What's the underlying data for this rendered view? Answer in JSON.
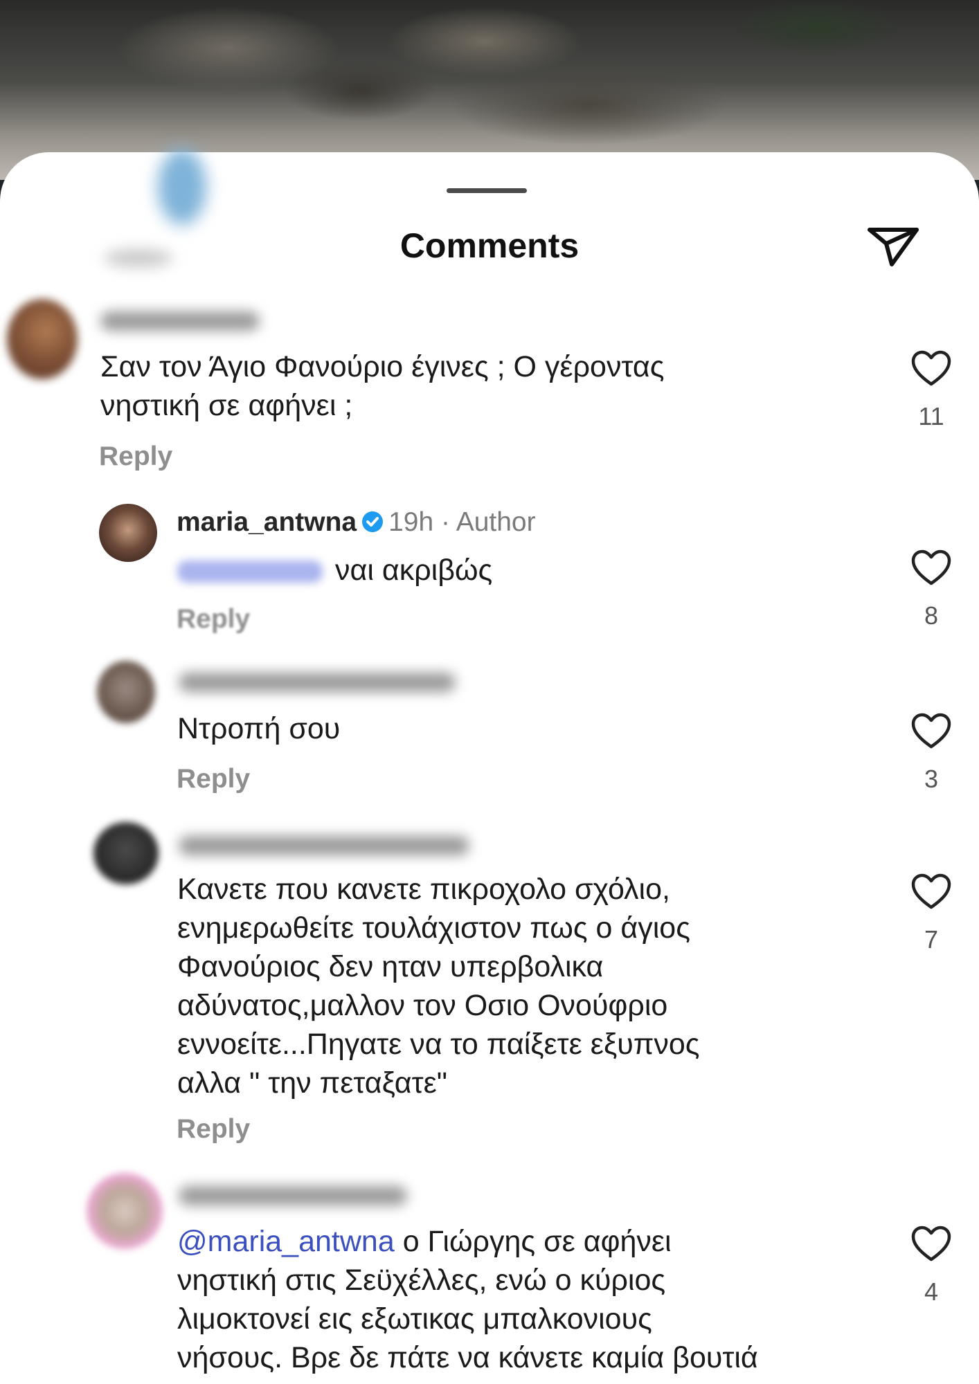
{
  "sheet": {
    "title": "Comments"
  },
  "comments": [
    {
      "text": "Σαν τον Άγιο Φανούριο έγινες ; Ο γέροντας\nνηστική σε αφήνει ;",
      "reply_label": "Reply",
      "likes": "11"
    },
    {
      "username": "maria_antwna",
      "time": "19h",
      "tag": "Author",
      "text": "ναι ακριβώς",
      "reply_label": "Reply",
      "likes": "8"
    },
    {
      "text": "Ντροπή σου",
      "reply_label": "Reply",
      "likes": "3"
    },
    {
      "text": "Κανετε που κανετε πικροχολο σχόλιο,\nενημερωθείτε τουλάχιστον πως ο άγιος\nΦανούριος δεν ηταν υπερβολικα\nαδύνατος,μαλλον τον Οσιο Ονούφριο\nεννοείτε...Πηγατε να το παίξετε εξυπνος\nαλλα \" την πεταξατε\"",
      "reply_label": "Reply",
      "likes": "7"
    },
    {
      "mention": "@maria_antwna",
      "text": " ο Γιώργης σε αφήνει\nνηστική στις Σεϋχέλλες, ενώ ο κύριος\nλιμοκτονεί εις εξωτικας μπαλκονιους\nνήσους. Βρε δε πάτε να κάνετε καμία βουτιά",
      "likes": "4"
    }
  ],
  "icons": {
    "send": "send-icon",
    "like": "heart-icon",
    "verified": "verified-badge-icon"
  },
  "colors": {
    "mention": "#3b4fbf",
    "verified": "#1d9bf0",
    "muted": "#8e8e8e"
  }
}
